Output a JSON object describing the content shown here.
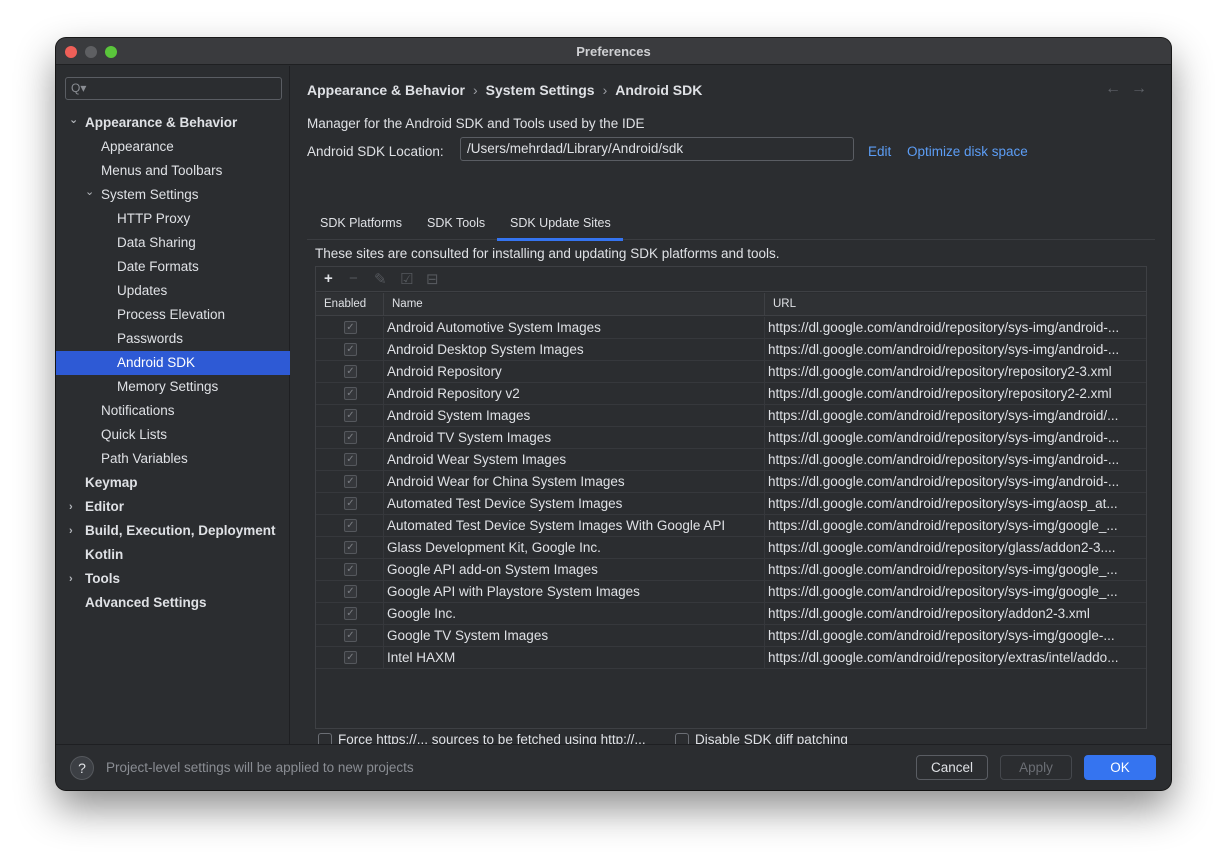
{
  "window": {
    "title": "Preferences"
  },
  "sidebar": {
    "search_placeholder": "Q▾",
    "items": [
      {
        "label": "Appearance & Behavior",
        "level": 0,
        "bold": true,
        "expanded": true
      },
      {
        "label": "Appearance",
        "level": 1
      },
      {
        "label": "Menus and Toolbars",
        "level": 1
      },
      {
        "label": "System Settings",
        "level": 1,
        "expanded": true
      },
      {
        "label": "HTTP Proxy",
        "level": 2
      },
      {
        "label": "Data Sharing",
        "level": 2
      },
      {
        "label": "Date Formats",
        "level": 2
      },
      {
        "label": "Updates",
        "level": 2
      },
      {
        "label": "Process Elevation",
        "level": 2
      },
      {
        "label": "Passwords",
        "level": 2
      },
      {
        "label": "Android SDK",
        "level": 2,
        "selected": true
      },
      {
        "label": "Memory Settings",
        "level": 2
      },
      {
        "label": "Notifications",
        "level": 1
      },
      {
        "label": "Quick Lists",
        "level": 1
      },
      {
        "label": "Path Variables",
        "level": 1
      },
      {
        "label": "Keymap",
        "level": 0,
        "bold": true
      },
      {
        "label": "Editor",
        "level": 0,
        "bold": true,
        "collapsed": true
      },
      {
        "label": "Build, Execution, Deployment",
        "level": 0,
        "bold": true,
        "collapsed": true
      },
      {
        "label": "Kotlin",
        "level": 0,
        "bold": true
      },
      {
        "label": "Tools",
        "level": 0,
        "bold": true,
        "collapsed": true
      },
      {
        "label": "Advanced Settings",
        "level": 0,
        "bold": true
      }
    ]
  },
  "breadcrumb": [
    "Appearance & Behavior",
    "System Settings",
    "Android SDK"
  ],
  "nav": {
    "back": "←",
    "forward": "→"
  },
  "main": {
    "description": "Manager for the Android SDK and Tools used by the IDE",
    "location_label": "Android SDK Location:",
    "location_value": "/Users/mehrdad/Library/Android/sdk",
    "edit_link": "Edit",
    "optimize_link": "Optimize disk space",
    "tabs": [
      "SDK Platforms",
      "SDK Tools",
      "SDK Update Sites"
    ],
    "active_tab": "SDK Update Sites",
    "sites_description": "These sites are consulted for installing and updating SDK platforms and tools."
  },
  "table": {
    "toolbar": {
      "add": "+",
      "remove": "−",
      "edit": "✎",
      "check": "☑",
      "uncheck": "⊟"
    },
    "headers": [
      "Enabled",
      "Name",
      "URL"
    ],
    "rows": [
      {
        "name": "Android Automotive System Images",
        "url": "https://dl.google.com/android/repository/sys-img/android-..."
      },
      {
        "name": "Android Desktop System Images",
        "url": "https://dl.google.com/android/repository/sys-img/android-..."
      },
      {
        "name": "Android Repository",
        "url": "https://dl.google.com/android/repository/repository2-3.xml"
      },
      {
        "name": "Android Repository v2",
        "url": "https://dl.google.com/android/repository/repository2-2.xml"
      },
      {
        "name": "Android System Images",
        "url": "https://dl.google.com/android/repository/sys-img/android/..."
      },
      {
        "name": "Android TV System Images",
        "url": "https://dl.google.com/android/repository/sys-img/android-..."
      },
      {
        "name": "Android Wear System Images",
        "url": "https://dl.google.com/android/repository/sys-img/android-..."
      },
      {
        "name": "Android Wear for China System Images",
        "url": "https://dl.google.com/android/repository/sys-img/android-..."
      },
      {
        "name": "Automated Test Device System Images",
        "url": "https://dl.google.com/android/repository/sys-img/aosp_at..."
      },
      {
        "name": "Automated Test Device System Images With Google API",
        "url": "https://dl.google.com/android/repository/sys-img/google_..."
      },
      {
        "name": "Glass Development Kit, Google Inc.",
        "url": "https://dl.google.com/android/repository/glass/addon2-3...."
      },
      {
        "name": "Google API add-on System Images",
        "url": "https://dl.google.com/android/repository/sys-img/google_..."
      },
      {
        "name": "Google API with Playstore System Images",
        "url": "https://dl.google.com/android/repository/sys-img/google_..."
      },
      {
        "name": "Google Inc.",
        "url": "https://dl.google.com/android/repository/addon2-3.xml"
      },
      {
        "name": "Google TV System Images",
        "url": "https://dl.google.com/android/repository/sys-img/google-..."
      },
      {
        "name": "Intel HAXM",
        "url": "https://dl.google.com/android/repository/extras/intel/addo..."
      }
    ]
  },
  "options": {
    "force_https": "Force https://... sources to be fetched using http://...",
    "disable_diff": "Disable SDK diff patching"
  },
  "footer": {
    "help": "?",
    "note": "Project-level settings will be applied to new projects",
    "cancel": "Cancel",
    "apply": "Apply",
    "ok": "OK"
  },
  "colors": {
    "accent": "#3574f0",
    "selection": "#2e5ad5",
    "link": "#5c9df5",
    "background": "#2b2d30"
  }
}
